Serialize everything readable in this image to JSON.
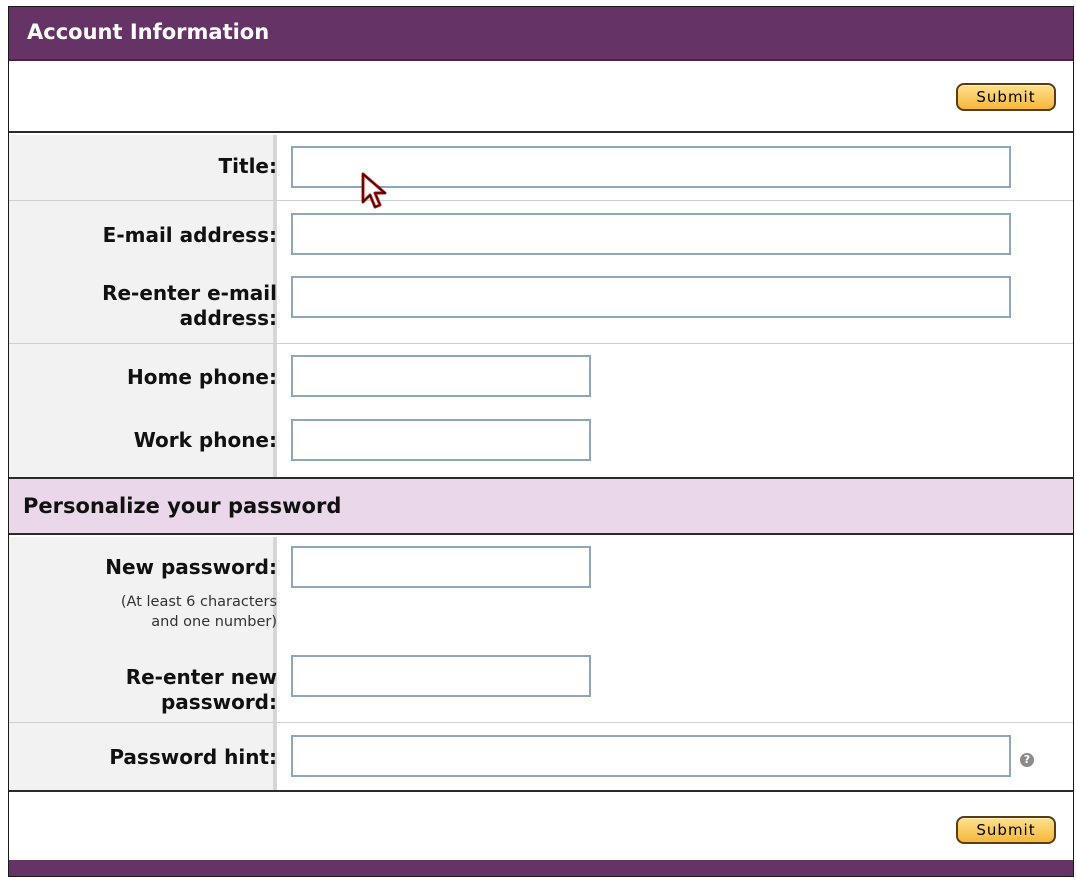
{
  "header": {
    "title": "Account Information"
  },
  "actions": {
    "submit_label": "Submit"
  },
  "fields": {
    "title": {
      "label": "Title:",
      "value": ""
    },
    "email": {
      "label": "E-mail address:",
      "value": ""
    },
    "email_confirm": {
      "label_line1": "Re-enter e-mail",
      "label_line2": "address:",
      "value": ""
    },
    "home_phone": {
      "label": "Home phone:",
      "value": ""
    },
    "work_phone": {
      "label": "Work phone:",
      "value": ""
    }
  },
  "password_section": {
    "title": "Personalize your password",
    "new_password": {
      "label": "New password:",
      "note_line1": "(At least 6 characters",
      "note_line2": "and one number)",
      "value": ""
    },
    "confirm_password": {
      "label_line1": "Re-enter new",
      "label_line2": "password:",
      "value": ""
    },
    "hint": {
      "label": "Password hint:",
      "value": ""
    },
    "help_icon": "question-icon"
  },
  "colors": {
    "header": "#663366",
    "section": "#ead8ea",
    "button": "#f7b73a",
    "input_border": "#8fa6c0"
  }
}
